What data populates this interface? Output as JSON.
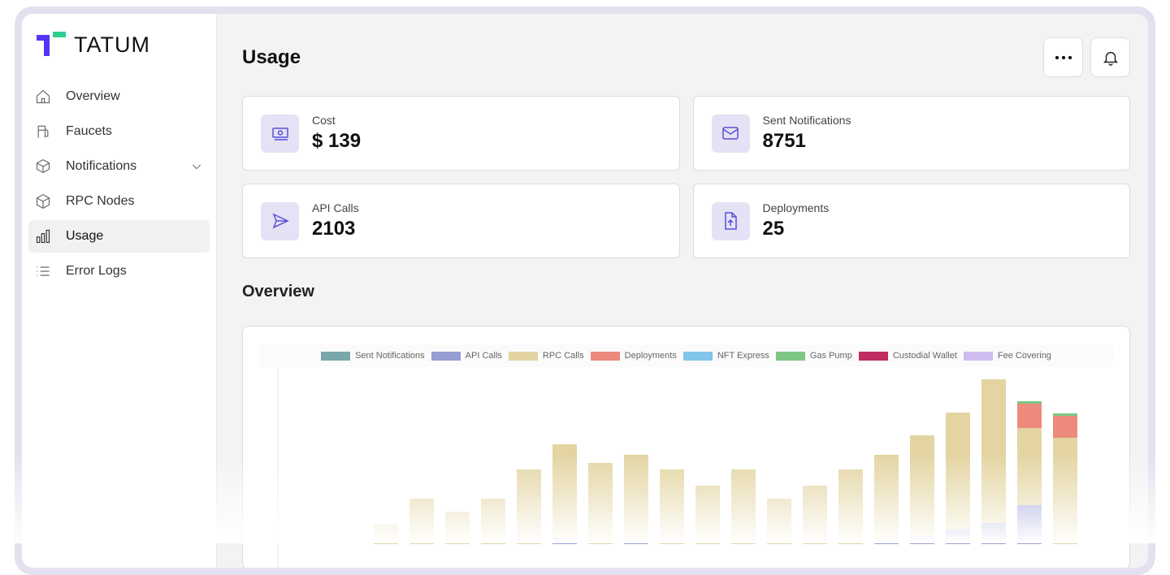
{
  "brand": "TATUM",
  "sidebar": {
    "items": [
      {
        "label": "Overview",
        "icon": "home-icon"
      },
      {
        "label": "Faucets",
        "icon": "fuel-icon"
      },
      {
        "label": "Notifications",
        "icon": "package-icon"
      },
      {
        "label": "RPC Nodes",
        "icon": "cube-icon"
      },
      {
        "label": "Usage",
        "icon": "bar-chart-icon"
      },
      {
        "label": "Error Logs",
        "icon": "list-icon"
      }
    ]
  },
  "header": {
    "title": "Usage"
  },
  "stats": [
    {
      "label": "Cost",
      "value": "$ 139"
    },
    {
      "label": "Sent Notifications",
      "value": "8751"
    },
    {
      "label": "API Calls",
      "value": "2103"
    },
    {
      "label": "Deployments",
      "value": "25"
    }
  ],
  "section_title": "Overview",
  "chart_data": {
    "type": "bar",
    "stacked": true,
    "legend": [
      {
        "name": "Sent Notifications",
        "color": "#7aa8aa"
      },
      {
        "name": "API Calls",
        "color": "#979ed4"
      },
      {
        "name": "RPC Calls",
        "color": "#e3d4a1"
      },
      {
        "name": "Deployments",
        "color": "#ec8a7c"
      },
      {
        "name": "NFT Express",
        "color": "#82c5ea"
      },
      {
        "name": "Gas Pump",
        "color": "#7ec783"
      },
      {
        "name": "Custodial Wallet",
        "color": "#bf2d62"
      },
      {
        "name": "Fee Covering",
        "color": "#d0bdf0"
      }
    ],
    "series": [
      {
        "name": "API Calls",
        "values": [
          0,
          0,
          0,
          0,
          0,
          8,
          0,
          6,
          0,
          0,
          0,
          0,
          0,
          0,
          6,
          10,
          18,
          26,
          48,
          0
        ]
      },
      {
        "name": "RPC Calls",
        "values": [
          24,
          56,
          40,
          56,
          92,
          115,
          100,
          104,
          92,
          72,
          92,
          56,
          72,
          92,
          104,
          124,
          144,
          177,
          95,
          131
        ]
      },
      {
        "name": "Deployments",
        "values": [
          0,
          0,
          0,
          0,
          0,
          0,
          0,
          0,
          0,
          0,
          0,
          0,
          0,
          0,
          0,
          0,
          0,
          0,
          30,
          27
        ]
      },
      {
        "name": "Gas Pump",
        "values": [
          0,
          0,
          0,
          0,
          0,
          0,
          0,
          0,
          0,
          0,
          0,
          0,
          0,
          0,
          0,
          0,
          0,
          0,
          3,
          3
        ]
      }
    ]
  }
}
